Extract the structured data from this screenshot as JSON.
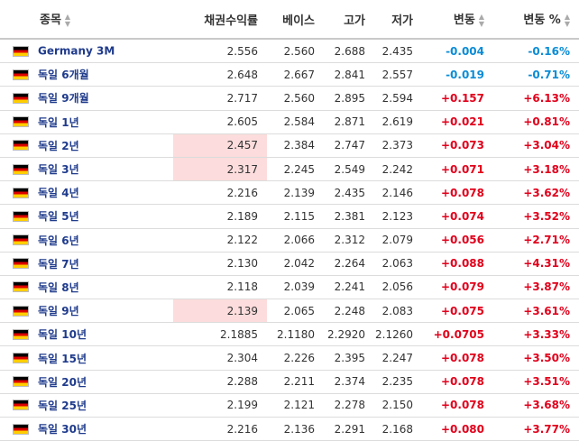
{
  "headers": {
    "name": "종목",
    "yield": "채권수익률",
    "base": "베이스",
    "high": "고가",
    "low": "저가",
    "change": "변동",
    "change_pct": "변동 %"
  },
  "colors": {
    "positive": "#e1001b",
    "negative": "#0a8cd6",
    "highlight": "#fcdcdc",
    "link": "#1f3b8c"
  },
  "rows": [
    {
      "name": "Germany 3M",
      "yield": "2.556",
      "base": "2.560",
      "high": "2.688",
      "low": "2.435",
      "change": "-0.004",
      "change_pct": "-0.16%",
      "dir": "neg",
      "highlight": false
    },
    {
      "name": "독일 6개월",
      "yield": "2.648",
      "base": "2.667",
      "high": "2.841",
      "low": "2.557",
      "change": "-0.019",
      "change_pct": "-0.71%",
      "dir": "neg",
      "highlight": false
    },
    {
      "name": "독일 9개월",
      "yield": "2.717",
      "base": "2.560",
      "high": "2.895",
      "low": "2.594",
      "change": "+0.157",
      "change_pct": "+6.13%",
      "dir": "pos",
      "highlight": false
    },
    {
      "name": "독일 1년",
      "yield": "2.605",
      "base": "2.584",
      "high": "2.871",
      "low": "2.619",
      "change": "+0.021",
      "change_pct": "+0.81%",
      "dir": "pos",
      "highlight": false
    },
    {
      "name": "독일 2년",
      "yield": "2.457",
      "base": "2.384",
      "high": "2.747",
      "low": "2.373",
      "change": "+0.073",
      "change_pct": "+3.04%",
      "dir": "pos",
      "highlight": true
    },
    {
      "name": "독일 3년",
      "yield": "2.317",
      "base": "2.245",
      "high": "2.549",
      "low": "2.242",
      "change": "+0.071",
      "change_pct": "+3.18%",
      "dir": "pos",
      "highlight": true
    },
    {
      "name": "독일 4년",
      "yield": "2.216",
      "base": "2.139",
      "high": "2.435",
      "low": "2.146",
      "change": "+0.078",
      "change_pct": "+3.62%",
      "dir": "pos",
      "highlight": false
    },
    {
      "name": "독일 5년",
      "yield": "2.189",
      "base": "2.115",
      "high": "2.381",
      "low": "2.123",
      "change": "+0.074",
      "change_pct": "+3.52%",
      "dir": "pos",
      "highlight": false
    },
    {
      "name": "독일 6년",
      "yield": "2.122",
      "base": "2.066",
      "high": "2.312",
      "low": "2.079",
      "change": "+0.056",
      "change_pct": "+2.71%",
      "dir": "pos",
      "highlight": false
    },
    {
      "name": "독일 7년",
      "yield": "2.130",
      "base": "2.042",
      "high": "2.264",
      "low": "2.063",
      "change": "+0.088",
      "change_pct": "+4.31%",
      "dir": "pos",
      "highlight": false
    },
    {
      "name": "독일 8년",
      "yield": "2.118",
      "base": "2.039",
      "high": "2.241",
      "low": "2.056",
      "change": "+0.079",
      "change_pct": "+3.87%",
      "dir": "pos",
      "highlight": false
    },
    {
      "name": "독일 9년",
      "yield": "2.139",
      "base": "2.065",
      "high": "2.248",
      "low": "2.083",
      "change": "+0.075",
      "change_pct": "+3.61%",
      "dir": "pos",
      "highlight": true
    },
    {
      "name": "독일 10년",
      "yield": "2.1885",
      "base": "2.1180",
      "high": "2.2920",
      "low": "2.1260",
      "change": "+0.0705",
      "change_pct": "+3.33%",
      "dir": "pos",
      "highlight": false
    },
    {
      "name": "독일 15년",
      "yield": "2.304",
      "base": "2.226",
      "high": "2.395",
      "low": "2.247",
      "change": "+0.078",
      "change_pct": "+3.50%",
      "dir": "pos",
      "highlight": false
    },
    {
      "name": "독일 20년",
      "yield": "2.288",
      "base": "2.211",
      "high": "2.374",
      "low": "2.235",
      "change": "+0.078",
      "change_pct": "+3.51%",
      "dir": "pos",
      "highlight": false
    },
    {
      "name": "독일 25년",
      "yield": "2.199",
      "base": "2.121",
      "high": "2.278",
      "low": "2.150",
      "change": "+0.078",
      "change_pct": "+3.68%",
      "dir": "pos",
      "highlight": false
    },
    {
      "name": "독일 30년",
      "yield": "2.216",
      "base": "2.136",
      "high": "2.291",
      "low": "2.168",
      "change": "+0.080",
      "change_pct": "+3.77%",
      "dir": "pos",
      "highlight": false
    }
  ]
}
